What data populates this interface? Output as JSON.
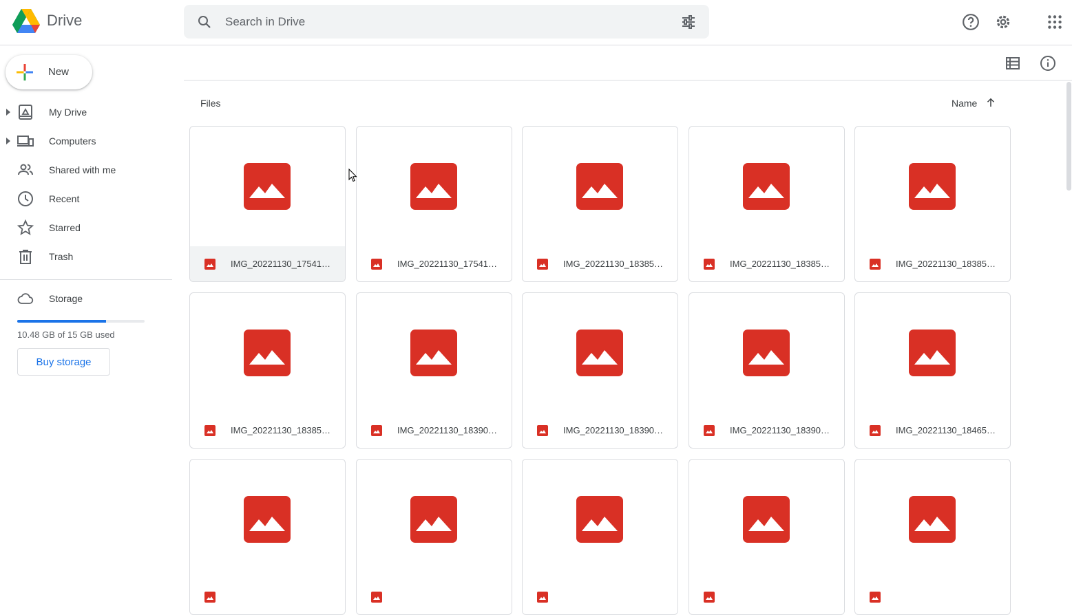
{
  "app": {
    "name": "Drive"
  },
  "search": {
    "placeholder": "Search in Drive"
  },
  "top_icons": [
    "search-options-icon",
    "help-icon",
    "settings-icon",
    "apps-grid-icon"
  ],
  "sidebar": {
    "new_label": "New",
    "items": [
      {
        "label": "My Drive",
        "icon": "my-drive-icon",
        "expandable": true
      },
      {
        "label": "Computers",
        "icon": "computers-icon",
        "expandable": true
      },
      {
        "label": "Shared with me",
        "icon": "shared-icon",
        "expandable": false
      },
      {
        "label": "Recent",
        "icon": "clock-icon",
        "expandable": false
      },
      {
        "label": "Starred",
        "icon": "star-icon",
        "expandable": false
      },
      {
        "label": "Trash",
        "icon": "trash-icon",
        "expandable": false
      }
    ],
    "storage": {
      "label": "Storage",
      "usage_text": "10.48 GB of 15 GB used",
      "used_fraction": 0.699,
      "buy_label": "Buy storage"
    }
  },
  "content": {
    "section_label": "Files",
    "sort_label": "Name",
    "sort_direction": "ascending",
    "files": [
      {
        "name": "IMG_20221130_17541…",
        "selected": true
      },
      {
        "name": "IMG_20221130_17541…",
        "selected": false
      },
      {
        "name": "IMG_20221130_18385…",
        "selected": false
      },
      {
        "name": "IMG_20221130_18385…",
        "selected": false
      },
      {
        "name": "IMG_20221130_18385…",
        "selected": false
      },
      {
        "name": "IMG_20221130_18385…",
        "selected": false
      },
      {
        "name": "IMG_20221130_18390…",
        "selected": false
      },
      {
        "name": "IMG_20221130_18390…",
        "selected": false
      },
      {
        "name": "IMG_20221130_18390…",
        "selected": false
      },
      {
        "name": "IMG_20221130_18465…",
        "selected": false
      },
      {
        "name": "",
        "selected": false
      },
      {
        "name": "",
        "selected": false
      },
      {
        "name": "",
        "selected": false
      },
      {
        "name": "",
        "selected": false
      },
      {
        "name": "",
        "selected": false
      }
    ]
  },
  "colors": {
    "accent": "#1a73e8",
    "image_red": "#d93025",
    "selected_bg": "#f1f3f4",
    "border": "#dadce0"
  }
}
